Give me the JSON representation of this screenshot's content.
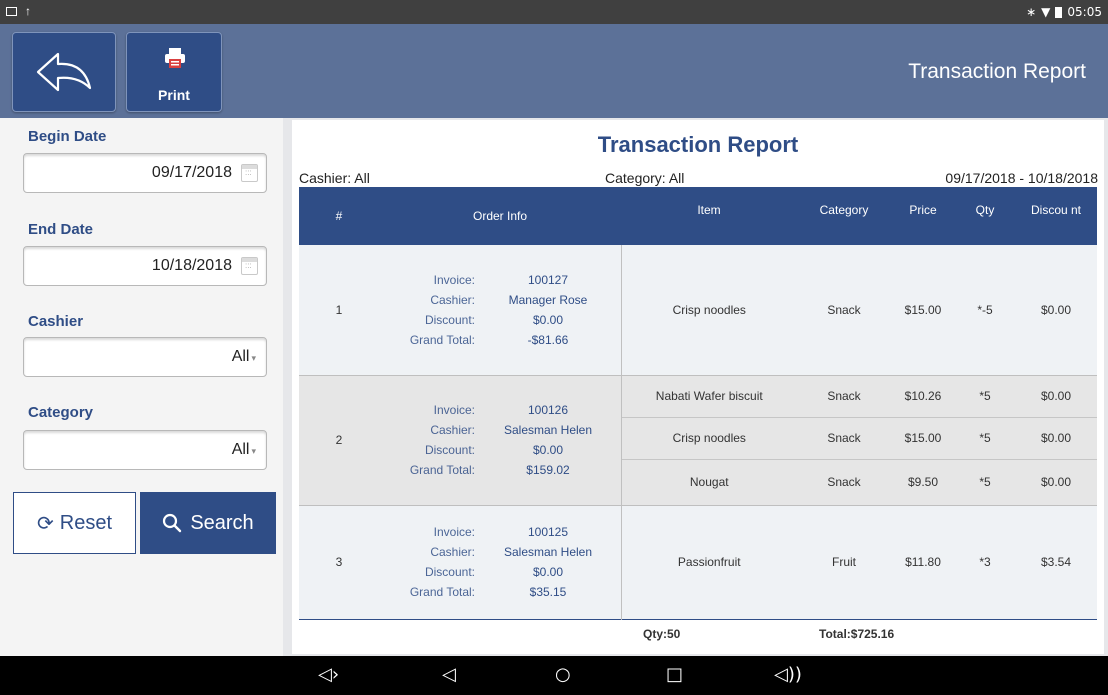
{
  "statusbar": {
    "time": "05:05",
    "left_icons": [
      "screenshot-icon",
      "upload-icon"
    ],
    "right_icons": [
      "bluetooth-icon",
      "wifi-icon",
      "battery-icon"
    ]
  },
  "header": {
    "title": "Transaction Report",
    "print_label": "Print"
  },
  "filters": {
    "begin_label": "Begin Date",
    "begin_value": "09/17/2018",
    "end_label": "End Date",
    "end_value": "10/18/2018",
    "cashier_label": "Cashier",
    "cashier_value": "All",
    "category_label": "Category",
    "category_value": "All",
    "reset_label": "Reset",
    "search_label": "Search"
  },
  "report": {
    "title": "Transaction Report",
    "cashier": "Cashier: All",
    "category": "Category: All",
    "range": "09/17/2018 - 10/18/2018",
    "columns": [
      "#",
      "Order Info",
      "Item",
      "Category",
      "Price",
      "Qty",
      "Discou nt"
    ],
    "orderinfo_keys": {
      "invoice": "Invoice:",
      "cashier": "Cashier:",
      "discount": "Discount:",
      "grand_total": "Grand Total:"
    },
    "orders": [
      {
        "num": "1",
        "invoice": "100127",
        "cashier": "Manager Rose",
        "discount": "$0.00",
        "grand_total": "-$81.66",
        "items": [
          {
            "item": "Crisp noodles",
            "category": "Snack",
            "price": "$15.00",
            "qty": "*-5",
            "discount": "$0.00"
          }
        ]
      },
      {
        "num": "2",
        "invoice": "100126",
        "cashier": "Salesman Helen",
        "discount": "$0.00",
        "grand_total": "$159.02",
        "items": [
          {
            "item": "Nabati Wafer biscuit",
            "category": "Snack",
            "price": "$10.26",
            "qty": "*5",
            "discount": "$0.00"
          },
          {
            "item": "Crisp noodles",
            "category": "Snack",
            "price": "$15.00",
            "qty": "*5",
            "discount": "$0.00"
          },
          {
            "item": "Nougat",
            "category": "Snack",
            "price": "$9.50",
            "qty": "*5",
            "discount": "$0.00"
          }
        ]
      },
      {
        "num": "3",
        "invoice": "100125",
        "cashier": "Salesman Helen",
        "discount": "$0.00",
        "grand_total": "$35.15",
        "items": [
          {
            "item": "Passionfruit",
            "category": "Fruit",
            "price": "$11.80",
            "qty": "*3",
            "discount": "$3.54"
          }
        ]
      }
    ],
    "total_qty": "Qty:50",
    "total_amount": "Total:$725.16"
  },
  "navbar": {
    "icons": [
      "volume-down-icon",
      "back-icon",
      "home-icon",
      "recents-icon",
      "volume-up-icon"
    ]
  },
  "colors": {
    "primary": "#2f4d86",
    "header": "#5c7198",
    "row_odd": "#eff2f5",
    "row_even": "#e6e6e6"
  }
}
